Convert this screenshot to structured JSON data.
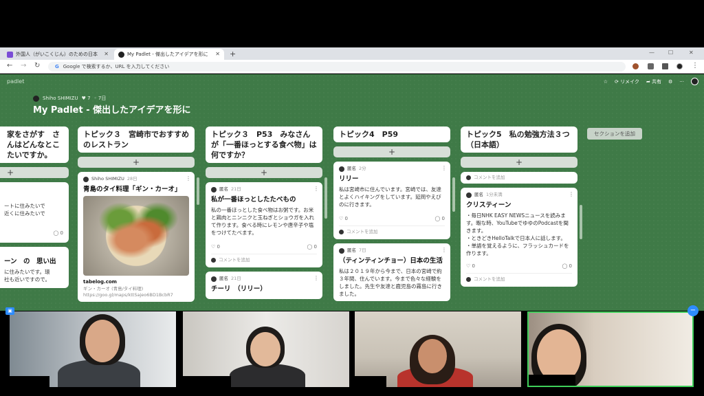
{
  "browser": {
    "tabs": [
      {
        "title": "外国人（がいこくじん）のための日本"
      },
      {
        "title": "My Padlet - 傑出したアイデアを形に"
      }
    ],
    "new_tab": "+",
    "omnibox_prefix": "G",
    "omnibox_placeholder": "Google で検索するか、URL を入力してください",
    "back": "←",
    "forward": "→",
    "reload": "↻",
    "minimize": "—",
    "maximize": "☐",
    "close": "✕"
  },
  "padlet": {
    "brand": "padlet",
    "top_actions": {
      "star": "☆",
      "remake": "リメイク",
      "share": "共有",
      "settings": "⚙",
      "more": "···"
    },
    "author": "Shiho SHIMIZU",
    "likes": "7",
    "age": "7日",
    "title": "My Padlet - 傑出したアイデアを形に",
    "add_section": "セクションを追加",
    "columns": [
      {
        "header": "家をさがす　さんはどんなとこ　たいですか。",
        "cards": [
          {
            "body": "ートに住みたいで\n近くに住みたいで",
            "reactions_right": "0"
          },
          {
            "title": "ーン　の　思い出",
            "body": "に住みたいです。環\n社も近いですので。"
          }
        ]
      },
      {
        "header": "トピック３　宮崎市でおすすめのレストラン",
        "cards": [
          {
            "author": "Shiho SHIMIZU",
            "time": "28日",
            "title": "青島のタイ料理「ギン・カーオ」",
            "link": "tabelog.com",
            "link_desc": "ギン・カーオ (青島/タイ料理)",
            "link_url": "https://goo.gl/maps/kttSajeo6BD1BcbR7"
          }
        ]
      },
      {
        "header": "トピック３　P53　みなさんが「一番ほっとする食べ物」は何ですか？",
        "cards": [
          {
            "author": "匿名",
            "time": "21日",
            "title": "私が一番ほっとしたたべもの",
            "body": "私の一番ほっとした食べ物はお粥です。お米と鶏肉とニンニクと玉ねぎとショウガを入れて作ります。食べる時にレモンや唐辛子や塩をつけてたべます。",
            "likes": "0",
            "comments": "0",
            "comment_placeholder": "コメントを追加"
          },
          {
            "author": "匿名",
            "time": "21日",
            "title": "チーリ　（リリー）"
          }
        ]
      },
      {
        "header": "トピック4　P59",
        "cards": [
          {
            "author": "匿名",
            "time": "2分",
            "title": "リリー",
            "body": "私は宮崎市に住んでいます。宮崎では、友達とよくハイキングをしています。延岡やえびのに行きます。",
            "likes": "0",
            "comments": "0",
            "comment_placeholder": "コメントを追加"
          },
          {
            "author": "匿名",
            "time": "7日",
            "title": "（ティンティンチョー）日本の生活",
            "body": "私は２０１９年から今まで、日本の宮崎で約３年間、住んでいます。今まで色々な経験をしました。先生や友達と鹿児島の霧島に行きました。"
          }
        ]
      },
      {
        "header": "トピック5　私の勉強方法３つ（日本語）",
        "cards": [
          {
            "comment_placeholder": "コメントを追加"
          },
          {
            "author": "匿名",
            "time": "1分未満",
            "title": "クリスティーン",
            "body": "・毎日NHK EASY NEWSニュースを読みます。暇な時、YouTubeでゆゆのPodcastを聞きます。\n・ときどきHelloTalkで日本人に話します。\n・単語を覚えるように、フラッシュカードを作ります。",
            "likes": "0",
            "comments": "0",
            "comment_placeholder": "コメントを追加"
          }
        ]
      }
    ]
  },
  "icons": {
    "plus": "+",
    "dots": "⋮",
    "heart": "♡",
    "comment": "◯"
  }
}
